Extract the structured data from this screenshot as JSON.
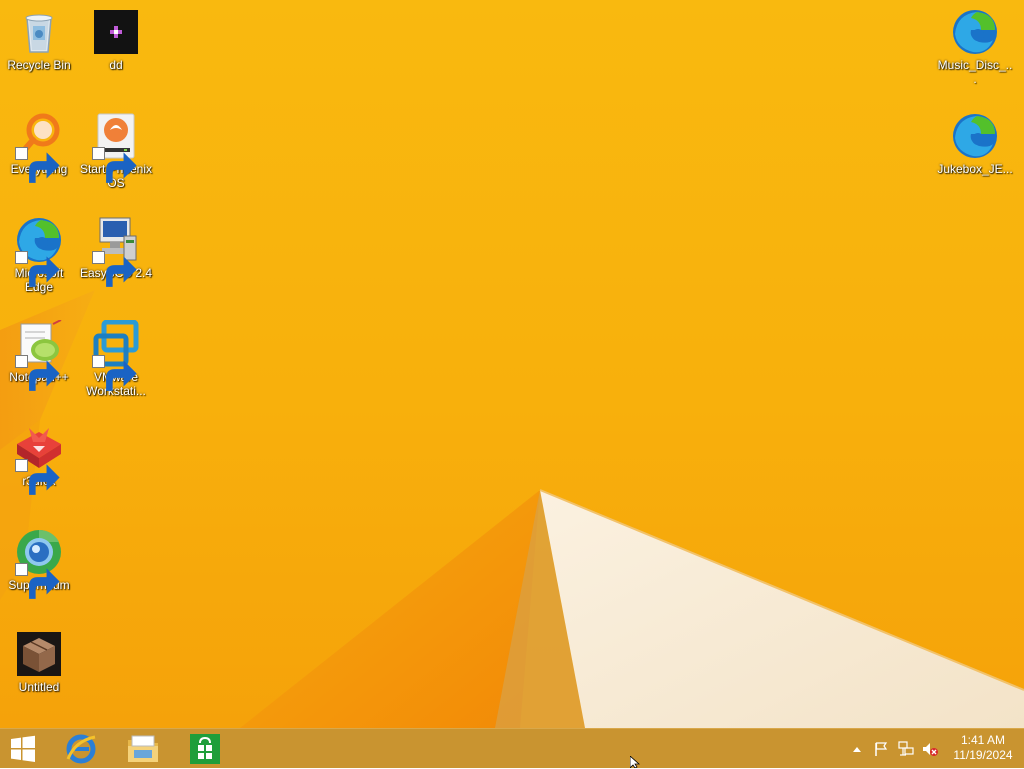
{
  "desktop": {
    "icons": [
      {
        "label": "Recycle Bin",
        "icon": "recycle-bin-icon",
        "shortcut": false
      },
      {
        "label": "dd",
        "icon": "dd-app-icon",
        "shortcut": false
      },
      {
        "label": "Everything",
        "icon": "everything-search-icon",
        "shortcut": true
      },
      {
        "label": "Start Phoenix OS",
        "icon": "phoenix-os-icon",
        "shortcut": true
      },
      {
        "label": "Microsoft Edge",
        "icon": "edge-icon",
        "shortcut": true
      },
      {
        "label": "EasyBCD 2.4",
        "icon": "easybcd-icon",
        "shortcut": true
      },
      {
        "label": "Notepad++",
        "icon": "notepadpp-icon",
        "shortcut": true
      },
      {
        "label": "VMware Workstati...",
        "icon": "vmware-icon",
        "shortcut": true
      },
      {
        "label": "r3dfox",
        "icon": "r3dfox-icon",
        "shortcut": true
      },
      {
        "label": "Supermium",
        "icon": "supermium-icon",
        "shortcut": true
      },
      {
        "label": "Untitled",
        "icon": "box-icon",
        "shortcut": false
      },
      {
        "label": "Music_Disc_...",
        "icon": "edge-icon",
        "shortcut": false
      },
      {
        "label": "Jukebox_JE...",
        "icon": "edge-icon",
        "shortcut": false
      }
    ]
  },
  "taskbar": {
    "start": "windows-logo-icon",
    "pinned": [
      {
        "name": "internet-explorer-icon"
      },
      {
        "name": "file-explorer-icon"
      },
      {
        "name": "store-icon"
      }
    ],
    "tray": {
      "time": "1:41 AM",
      "date": "11/19/2024"
    }
  },
  "colors": {
    "wallpaper_top": "#f9b90f",
    "wallpaper_bottom": "#f5a20a",
    "taskbar": "#c99430",
    "edge_blue": "#1a73c9",
    "edge_green": "#53c02b"
  }
}
